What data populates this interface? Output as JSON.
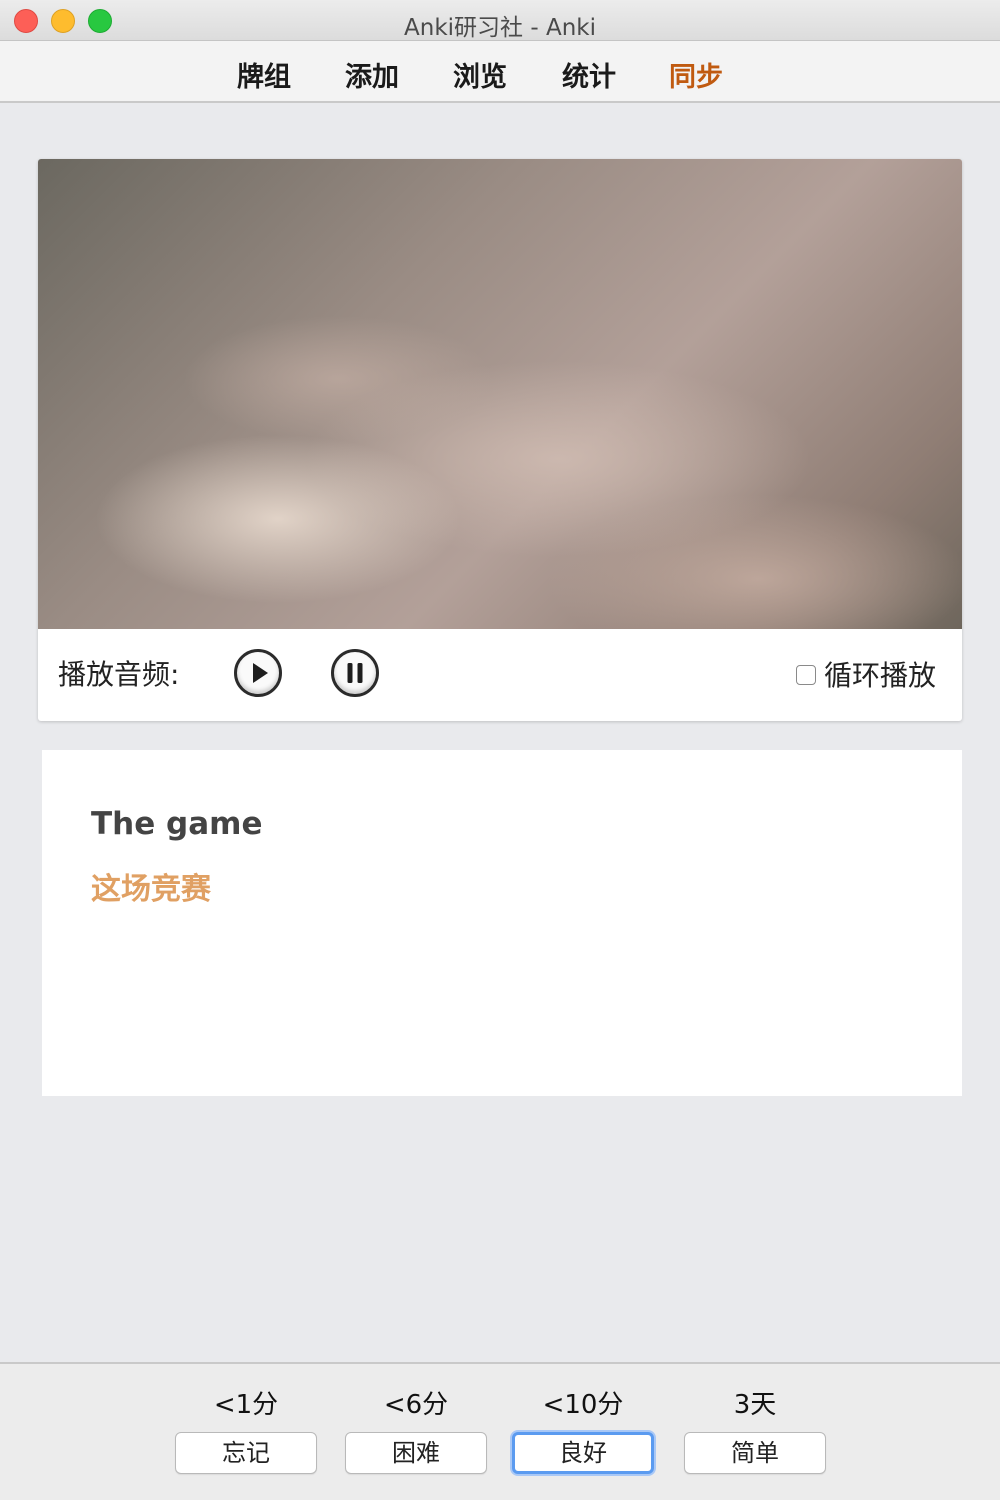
{
  "window": {
    "title": "Anki研习社 - Anki"
  },
  "toolbar": {
    "tabs": [
      {
        "label": "牌组"
      },
      {
        "label": "添加"
      },
      {
        "label": "浏览"
      },
      {
        "label": "统计"
      },
      {
        "label": "同步"
      }
    ],
    "highlight_color": "#c05a10"
  },
  "audio": {
    "label": "播放音频:",
    "play_icon": "play-icon",
    "pause_icon": "pause-icon",
    "loop_label": "循环播放",
    "loop_checked": false
  },
  "card": {
    "english": "The game",
    "chinese": "这场竞赛",
    "chinese_color": "#e0a063"
  },
  "answer_buttons": [
    {
      "interval": "<1分",
      "label": "忘记"
    },
    {
      "interval": "<6分",
      "label": "困难"
    },
    {
      "interval": "<10分",
      "label": "良好",
      "focused": true
    },
    {
      "interval": "3天",
      "label": "简单"
    }
  ]
}
